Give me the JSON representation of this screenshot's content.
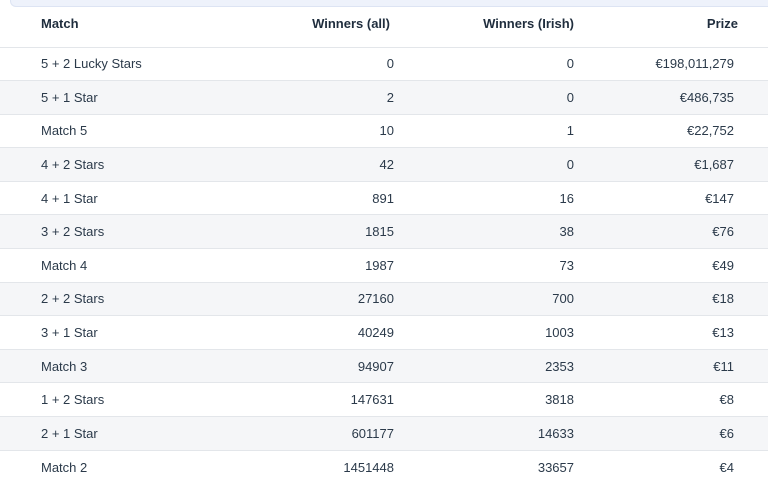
{
  "table": {
    "headers": {
      "match": "Match",
      "winners_all": "Winners (all)",
      "winners_irish": "Winners (Irish)",
      "prize": "Prize"
    },
    "rows": [
      {
        "match": "5 + 2 Lucky Stars",
        "winners_all": "0",
        "winners_irish": "0",
        "prize": "€198,011,279"
      },
      {
        "match": "5 + 1 Star",
        "winners_all": "2",
        "winners_irish": "0",
        "prize": "€486,735"
      },
      {
        "match": "Match 5",
        "winners_all": "10",
        "winners_irish": "1",
        "prize": "€22,752"
      },
      {
        "match": "4 + 2 Stars",
        "winners_all": "42",
        "winners_irish": "0",
        "prize": "€1,687"
      },
      {
        "match": "4 + 1 Star",
        "winners_all": "891",
        "winners_irish": "16",
        "prize": "€147"
      },
      {
        "match": "3 + 2 Stars",
        "winners_all": "1815",
        "winners_irish": "38",
        "prize": "€76"
      },
      {
        "match": "Match 4",
        "winners_all": "1987",
        "winners_irish": "73",
        "prize": "€49"
      },
      {
        "match": "2 + 2 Stars",
        "winners_all": "27160",
        "winners_irish": "700",
        "prize": "€18"
      },
      {
        "match": "3 + 1 Star",
        "winners_all": "40249",
        "winners_irish": "1003",
        "prize": "€13"
      },
      {
        "match": "Match 3",
        "winners_all": "94907",
        "winners_irish": "2353",
        "prize": "€11"
      },
      {
        "match": "1 + 2 Stars",
        "winners_all": "147631",
        "winners_irish": "3818",
        "prize": "€8"
      },
      {
        "match": "2 + 1 Star",
        "winners_all": "601177",
        "winners_irish": "14633",
        "prize": "€6"
      },
      {
        "match": "Match 2",
        "winners_all": "1451448",
        "winners_irish": "33657",
        "prize": "€4"
      }
    ]
  },
  "colors": {
    "row_alt": "#f5f6f8",
    "row_border": "#e3e6ea",
    "text": "#2b3a4a",
    "header_text": "#1f2d3d"
  }
}
